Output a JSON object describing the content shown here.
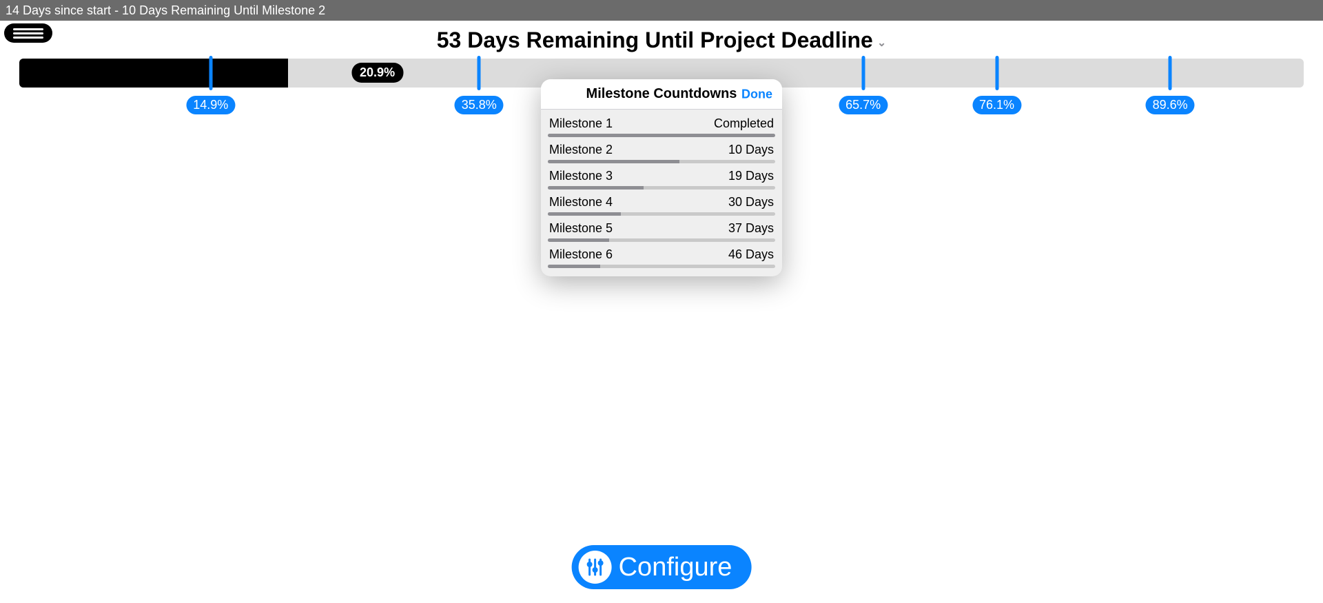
{
  "top_bar": {
    "status_text": "14 Days since start - 10 Days Remaining Until Milestone 2"
  },
  "header": {
    "title": "53 Days Remaining Until Project Deadline"
  },
  "progress": {
    "percent": 20.9,
    "current_badge": "20.9%",
    "milestones": [
      {
        "percent": 14.9,
        "label": "14.9%"
      },
      {
        "percent": 35.8,
        "label": "35.8%"
      },
      {
        "percent": 65.7,
        "label": "65.7%"
      },
      {
        "percent": 76.1,
        "label": "76.1%"
      },
      {
        "percent": 89.6,
        "label": "89.6%"
      }
    ]
  },
  "popover": {
    "title": "Milestone Countdowns",
    "done_label": "Done",
    "rows": [
      {
        "name": "Milestone 1",
        "status": "Completed",
        "bar_percent": 100
      },
      {
        "name": "Milestone 2",
        "status": "10 Days",
        "bar_percent": 58
      },
      {
        "name": "Milestone 3",
        "status": "19 Days",
        "bar_percent": 42
      },
      {
        "name": "Milestone 4",
        "status": "30 Days",
        "bar_percent": 32
      },
      {
        "name": "Milestone 5",
        "status": "37 Days",
        "bar_percent": 27
      },
      {
        "name": "Milestone 6",
        "status": "46 Days",
        "bar_percent": 23
      }
    ]
  },
  "configure": {
    "label": "Configure"
  }
}
